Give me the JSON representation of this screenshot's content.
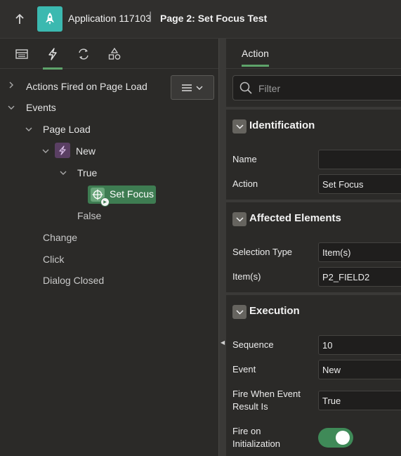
{
  "header": {
    "app_name": "Application 117103",
    "separator": "\\",
    "page_title": "Page 2: Set Focus Test"
  },
  "left_panel": {
    "tabs": [
      "rendering-icon",
      "dynamic-actions-icon",
      "processing-icon",
      "shared-components-icon"
    ],
    "tree": {
      "actions_fired": "Actions Fired on Page Load",
      "events": "Events",
      "page_load": "Page Load",
      "new": "New",
      "true_branch": "True",
      "set_focus": "Set Focus",
      "false_branch": "False",
      "change": "Change",
      "click": "Click",
      "dialog_closed": "Dialog Closed"
    }
  },
  "right_panel": {
    "tab": "Action",
    "filter_placeholder": "Filter",
    "identification": {
      "title": "Identification",
      "name_label": "Name",
      "name_value": "",
      "action_label": "Action",
      "action_value": "Set Focus"
    },
    "affected": {
      "title": "Affected Elements",
      "selection_label": "Selection Type",
      "selection_value": "Item(s)",
      "items_label": "Item(s)",
      "items_value": "P2_FIELD2"
    },
    "execution": {
      "title": "Execution",
      "sequence_label": "Sequence",
      "sequence_value": "10",
      "event_label": "Event",
      "event_value": "New",
      "fire_when_label": "Fire When Event Result Is",
      "fire_when_value": "True",
      "fire_init_label": "Fire on Initialization",
      "fire_init_on": true
    }
  },
  "colors": {
    "accent": "#5ea36a",
    "app_tile": "#3bb9b0",
    "action_node": "#3e7c52",
    "dynamic_action": "#5a3f63"
  }
}
